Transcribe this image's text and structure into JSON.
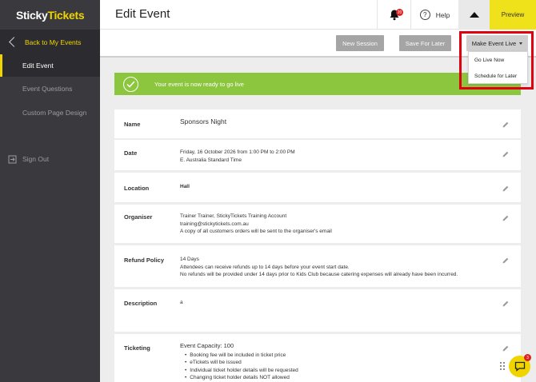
{
  "app": {
    "logo_part1": "Sticky",
    "logo_part2": "Tickets"
  },
  "sidebar": {
    "back_label": "Back to My Events",
    "items": [
      {
        "label": "Edit Event"
      },
      {
        "label": "Event Questions"
      },
      {
        "label": "Custom Page Design"
      }
    ],
    "signout_label": "Sign Out"
  },
  "header": {
    "title": "Edit Event",
    "notification_count": "20",
    "help_label": "Help",
    "preview_label": "Preview"
  },
  "actions": {
    "new_session": "New Session",
    "save_for_later": "Save For Later",
    "make_live": "Make Event Live",
    "menu": [
      "Go Live Now",
      "Schedule for Later"
    ]
  },
  "success_message": "Your event is now ready to go live",
  "fields": {
    "name": {
      "label": "Name",
      "value": "Sponsors Night"
    },
    "date": {
      "label": "Date",
      "line1": "Friday, 16 October 2026 from 1:00 PM to 2:00 PM",
      "line2": "E. Australia Standard Time"
    },
    "location": {
      "label": "Location",
      "value": "Hall"
    },
    "organiser": {
      "label": "Organiser",
      "line1": "Trainer Trainer, StickyTickets Training Account",
      "line2": "training@stickytickets.com.au",
      "line3": "A copy of all customers orders will be sent to the organiser's email"
    },
    "refund": {
      "label": "Refund Policy",
      "line1": "14 Days",
      "line2": "Attendees can receive refunds up to 14 days before your event start date.",
      "line3": "No refunds will be provided under 14 days prior to Kids Club because catering expenses will already have been incurred."
    },
    "description": {
      "label": "Description",
      "value": "a"
    },
    "ticketing": {
      "label": "Ticketing",
      "capacity": "Event Capacity: 100",
      "items": [
        "Booking fee will be included in ticket price",
        "eTickets will be issued",
        "Individual ticket holder details will be requested",
        "Changing ticket holder details NOT allowed"
      ]
    }
  },
  "chat": {
    "badge": "3"
  },
  "colors": {
    "accent": "#f0d400",
    "success": "#8cc63e",
    "sidebar": "#3a3a3e",
    "highlight": "#e0000f"
  }
}
